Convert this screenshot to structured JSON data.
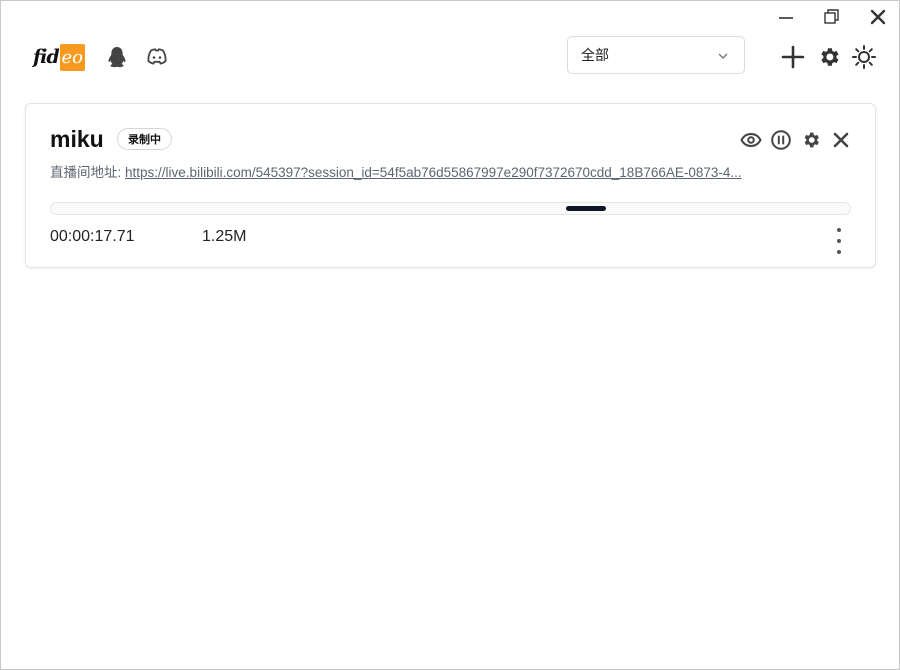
{
  "window": {
    "minimize_icon": "minimize-icon",
    "restore_icon": "restore-icon",
    "close_icon": "close-icon"
  },
  "header": {
    "logo": {
      "part1": "fid",
      "part2": "eo",
      "accent": "#f79a1e"
    },
    "qq_icon": "qq-penguin-icon",
    "discord_icon": "discord-icon",
    "filter": {
      "selected": "全部"
    },
    "add_icon": "plus-icon",
    "settings_icon": "gear-icon",
    "theme_icon": "sun-icon"
  },
  "task": {
    "name": "miku",
    "status_badge": "录制中",
    "url_label": "直播间地址:",
    "url": "https://live.bilibili.com/545397?session_id=54f5ab76d55867997e290f7372670cdd_18B766AE-0873-4...",
    "duration": "00:00:17.71",
    "size": "1.25M",
    "progress_fraction": 0.67,
    "actions": [
      "eye-icon",
      "pause-icon",
      "gear-icon",
      "close-icon"
    ]
  }
}
